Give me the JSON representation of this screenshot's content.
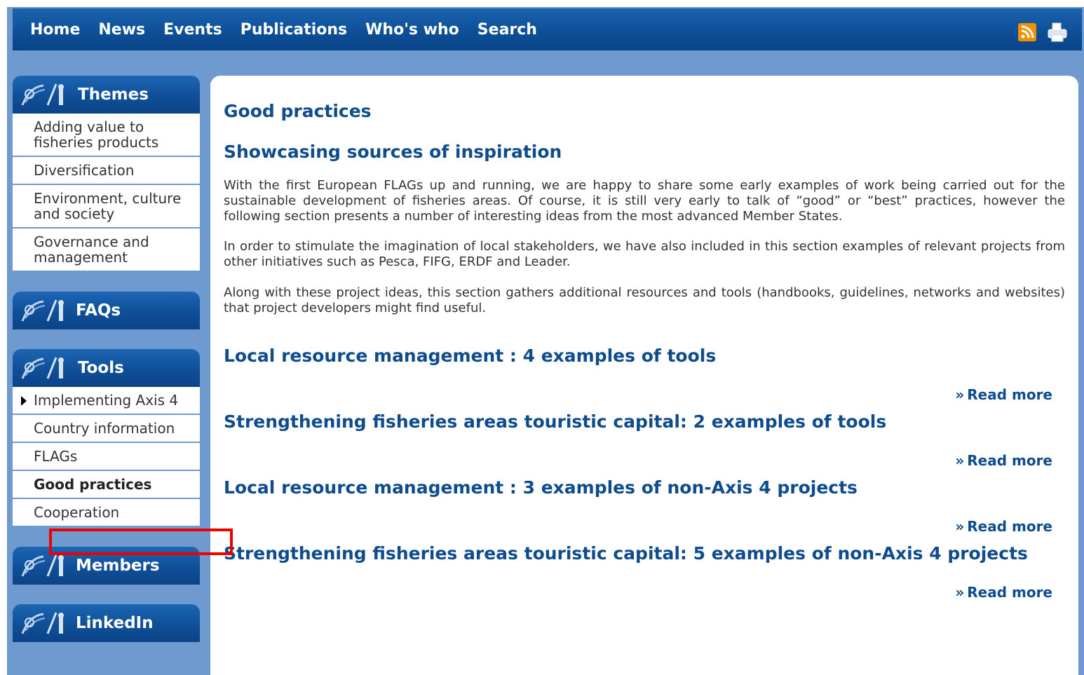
{
  "topnav": {
    "items": [
      "Home",
      "News",
      "Events",
      "Publications",
      "Who's who",
      "Search"
    ],
    "icons": [
      "rss-icon",
      "print-icon"
    ]
  },
  "sidebar": {
    "themes": {
      "title": "Themes",
      "items": [
        "Adding value to fisheries products",
        "Diversification",
        "Environment, culture and society",
        "Governance and management"
      ]
    },
    "faqs": {
      "title": "FAQs"
    },
    "tools": {
      "title": "Tools",
      "items": [
        "Implementing Axis 4",
        "Country information",
        "FLAGs",
        "Good practices",
        "Cooperation"
      ],
      "active": "Good practices"
    },
    "members": {
      "title": "Members"
    },
    "linkedin": {
      "title": "LinkedIn"
    }
  },
  "main": {
    "title": "Good practices",
    "subtitle": "Showcasing sources of inspiration",
    "paragraphs": [
      "With the first European FLAGs up and running, we are happy to share some early examples of work being carried out for the sustainable development of fisheries areas. Of course, it is still very early to talk of “good” or “best” practices, however the following section presents a number of interesting ideas from the most advanced Member States.",
      "In order to stimulate the imagination of local stakeholders, we have also included in this section examples of relevant projects from other initiatives such as Pesca, FIFG, ERDF and Leader.",
      "Along with these project ideas, this section gathers additional resources and tools (handbooks, guidelines, networks and websites) that project developers might find useful."
    ],
    "sections": [
      {
        "title": "Local resource management : 4 examples of tools",
        "read_more": "Read more"
      },
      {
        "title": "Strengthening fisheries areas touristic capital: 2 examples of tools",
        "read_more": "Read more"
      },
      {
        "title": "Local resource management : 3 examples of non-Axis 4 projects",
        "read_more": "Read more"
      },
      {
        "title": "Strengthening fisheries areas touristic capital: 5 examples of non-Axis 4 projects",
        "read_more": "Read more"
      }
    ],
    "read_more_prefix": "»"
  },
  "colors": {
    "nav_blue": "#0d4e96",
    "frame_blue": "#6e9ad0",
    "heading_blue": "#0f4c8d",
    "rss_orange": "#f29100",
    "highlight_red": "#ee0000"
  }
}
